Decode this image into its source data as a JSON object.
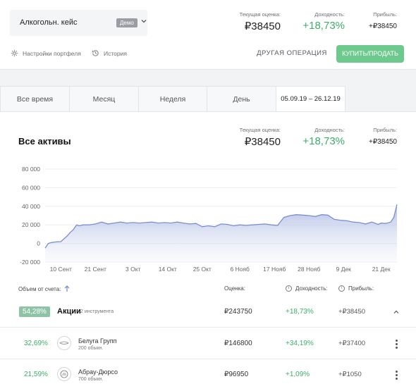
{
  "portfolio": {
    "name": "Алкогольн. кейс",
    "badge": "Демо"
  },
  "summary": {
    "value_label": "Текущая оценка:",
    "value": "₽38450",
    "yield_label": "Доходность:",
    "yield": "+18,73%",
    "profit_label": "Прибыль:",
    "profit": "+₽38450"
  },
  "links": {
    "settings": "Настройки портфеля",
    "history": "История"
  },
  "actions": {
    "other_op": "ДРУГАЯ ОПЕРАЦИЯ",
    "buy_sell": "КУПИТЬ/ПРОДАТЬ"
  },
  "tabs": [
    {
      "label": "Все время"
    },
    {
      "label": "Месяц"
    },
    {
      "label": "Неделя"
    },
    {
      "label": "День"
    },
    {
      "label": "05.09.19 – 26.12.19"
    }
  ],
  "section": {
    "title": "Все активы",
    "value_label": "Текущая оценка:",
    "value": "₽38450",
    "yield_label": "Доходность:",
    "yield": "+18,73%",
    "profit_label": "Прибыль:",
    "profit": "+₽38450"
  },
  "chart_data": {
    "type": "area",
    "y_ticks": [
      "80 000",
      "60 000",
      "40 000",
      "20 000",
      "0",
      "-20 000"
    ],
    "ylim": [
      -20000,
      80000
    ],
    "x_ticks": [
      "10 Сент",
      "21 Сент",
      "3 Окт",
      "14 Окт",
      "25 Окт",
      "6 Нояб",
      "17 Нояб",
      "28 Нояб",
      "9 Дек",
      "21 Дек"
    ],
    "x_tick_days": [
      5,
      16,
      28,
      39,
      50,
      62,
      73,
      84,
      95,
      107
    ],
    "x_range_days": [
      0,
      112
    ],
    "points_day": [
      0,
      1,
      2,
      3,
      4,
      5,
      6,
      7,
      8,
      9,
      10,
      11,
      12,
      14,
      16,
      18,
      20,
      22,
      24,
      26,
      28,
      30,
      32,
      34,
      36,
      38,
      40,
      42,
      44,
      46,
      48,
      50,
      52,
      54,
      56,
      58,
      60,
      62,
      64,
      66,
      68,
      70,
      72,
      74,
      76,
      78,
      80,
      82,
      84,
      86,
      88,
      90,
      92,
      94,
      96,
      98,
      100,
      102,
      104,
      106,
      107,
      108,
      109,
      110,
      111,
      112
    ],
    "values": [
      -5000,
      0,
      1000,
      1500,
      1800,
      2000,
      5000,
      8000,
      12000,
      15000,
      20000,
      19000,
      20000,
      20000,
      21000,
      23000,
      21000,
      22000,
      23000,
      22000,
      22500,
      22000,
      22500,
      23000,
      22000,
      22500,
      22000,
      23000,
      22000,
      21000,
      21500,
      18000,
      19000,
      18000,
      21000,
      20500,
      19000,
      20000,
      19500,
      20000,
      20500,
      21000,
      20000,
      19500,
      28000,
      30000,
      31000,
      30500,
      30000,
      29000,
      31000,
      30500,
      26000,
      25000,
      24500,
      23000,
      22500,
      21000,
      23000,
      20500,
      22000,
      21500,
      22000,
      23000,
      28000,
      42000
    ],
    "color": "#7b8fcf"
  },
  "table": {
    "col_share": "Объем от счета:",
    "col_value": "Оценка:",
    "col_yield": "Доходность:",
    "col_profit": "Прибыль:",
    "group": {
      "pct": "54,28%",
      "name": "Акции",
      "sub": "2 инструмента",
      "value": "₽243750",
      "yield": "+18,73%",
      "profit": "+₽38450"
    },
    "rows": [
      {
        "pct": "32,69%",
        "name": "Белуга Групп",
        "sub": "200 обыкн.",
        "value": "₽146800",
        "yield": "+34,19%",
        "profit": "+₽37400",
        "logo": "beluga-logo"
      },
      {
        "pct": "21,59%",
        "name": "Абрау-Дюрсо",
        "sub": "700 обыкн.",
        "value": "₽96950",
        "yield": "+1,09%",
        "profit": "+₽1050",
        "logo": "abrau-logo"
      }
    ]
  }
}
